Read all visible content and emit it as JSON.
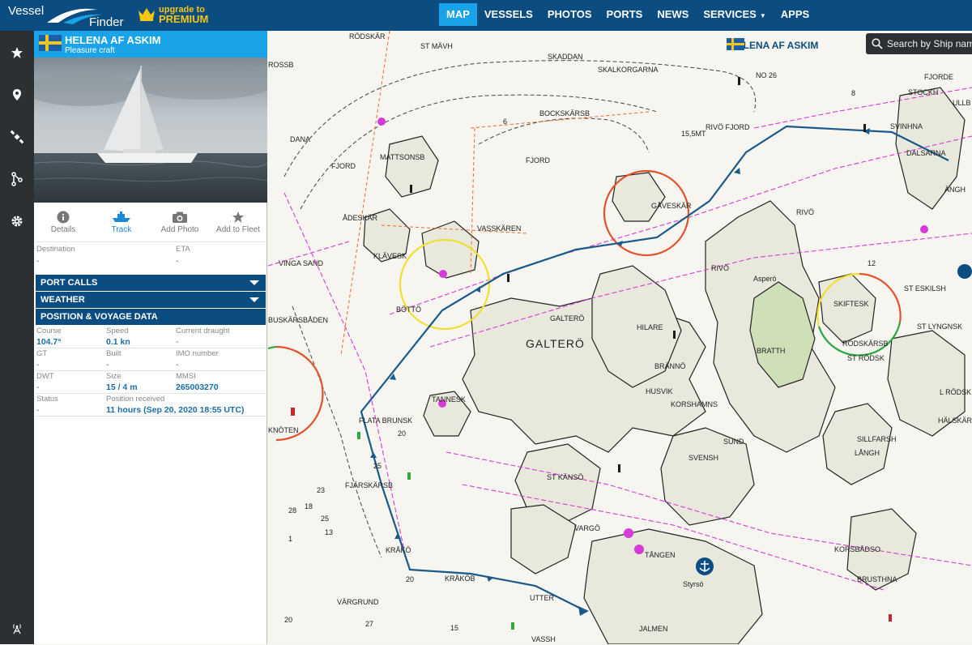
{
  "app": {
    "logo_line1": "Vessel",
    "logo_line2": "Finder"
  },
  "premium": {
    "line1": "upgrade to",
    "line2": "PREMIUM"
  },
  "nav": [
    {
      "label": "MAP",
      "active": true
    },
    {
      "label": "VESSELS"
    },
    {
      "label": "PHOTOS"
    },
    {
      "label": "PORTS"
    },
    {
      "label": "NEWS"
    },
    {
      "label": "SERVICES"
    },
    {
      "label": "APPS"
    }
  ],
  "rail_icons": [
    "star-icon",
    "map-pin-icon",
    "satellite-icon",
    "route-icon",
    "gear-icon",
    "antenna-icon"
  ],
  "vessel": {
    "name": "HELENA AF ASKIM",
    "type": "Pleasure craft",
    "flag_colors": {
      "blue": "#1b5fa8",
      "yellow": "#f5c518"
    }
  },
  "actions": [
    {
      "label": "Details",
      "icon": "info-icon"
    },
    {
      "label": "Track",
      "icon": "ship-track-icon",
      "active": true
    },
    {
      "label": "Add Photo",
      "icon": "camera-icon"
    },
    {
      "label": "Add to Fleet",
      "icon": "star-icon"
    }
  ],
  "destination": {
    "label": "Destination",
    "value": "-"
  },
  "eta": {
    "label": "ETA",
    "value": "-"
  },
  "sections": {
    "port_calls": "PORT CALLS",
    "weather": "WEATHER",
    "position": "POSITION & VOYAGE DATA"
  },
  "voyage": {
    "course": {
      "label": "Course",
      "value": "104.7°"
    },
    "speed": {
      "label": "Speed",
      "value": "0.1 kn"
    },
    "draught": {
      "label": "Current draught",
      "value": "-"
    },
    "gt": {
      "label": "GT",
      "value": "-"
    },
    "built": {
      "label": "Built",
      "value": "-"
    },
    "imo": {
      "label": "IMO number",
      "value": "-"
    },
    "dwt": {
      "label": "DWT",
      "value": "-"
    },
    "size": {
      "label": "Size",
      "value": "15 / 4 m"
    },
    "mmsi": {
      "label": "MMSI",
      "value": "265003270"
    },
    "status": {
      "label": "Status",
      "value": "-"
    },
    "position_received": {
      "label": "Position received",
      "value": "11 hours (Sep 20, 2020 18:55 UTC)"
    }
  },
  "map": {
    "vessel_label": "HELENA AF ASKIM",
    "search_placeholder": "Search by Ship name",
    "labels": {
      "galtero_big": "GALTERÖ",
      "rodskar": "RÖDSKÄR",
      "st_mavh": "ST MÄVH",
      "skaddan": "SKADDAN",
      "skalkorgarna": "SKALKORGARNA",
      "no26": "NO 26",
      "fjorde": "FJORDE",
      "rossb": "ROSSB",
      "stockh": "STOCKH",
      "ullb": "ULLB",
      "bockskarsb": "BOCKSKÄRSB",
      "rivo_fjord": "RIVÖ FJORD",
      "svinhna": "SVINHNA",
      "dana": "DANA",
      "mattsonsb": "MATTSONSB",
      "fjord_left": "FJORD",
      "fjord_mid": "FJORD",
      "mt15": "15,5MT",
      "dalsarna": "DALSARNA",
      "angh": "ÄNGH",
      "gaveskar": "GÅVESKÄR",
      "adeskar": "ÅDESKÄR",
      "vasskaren": "VASSKÄREN",
      "rivo_n": "RIVÖ",
      "rivo": "RIVÖ",
      "aspero": "Asperö",
      "vinga_sand": "VINGA SAND",
      "klavesk": "KLÄVESK",
      "skiftesk": "SKIFTESK",
      "st_eskilsh": "ST ESKILSH",
      "botto": "BÖTTÖ",
      "galtero_small": "GALTERÖ",
      "hilare": "HILARE",
      "st_lyngnsk": "ST LYNGNSK",
      "buskarsbaden": "BUSKÄRSBÅDEN",
      "rodskarsb": "RÖDSKÄRSB",
      "st_rodsk": "ST RÖDSK",
      "brattn": "BRATTH",
      "branno": "BRÄNNÖ",
      "l_rodsk": "L RÖDSK",
      "husvik": "HUSVIK",
      "korshamn": "KORSHAMNS",
      "tannesk": "TANNESK",
      "halskar": "HÄLSKÄR",
      "flata_brunsk": "FLATA BRUNSK",
      "sund": "SUND",
      "sillfarsh": "SILLFARSH",
      "knoten": "KNÖTEN",
      "svensh": "SVENSH",
      "langh": "LÅNGH",
      "st_kanso": "ST KÄNSÖ",
      "fjarskarsb": "FJÄRSKÄRSB",
      "vargo": "VARGÖ",
      "korsbadso": "KORSBÅDSO",
      "krako": "KRÅKÖ",
      "tangen": "TÅNGEN",
      "styrso": "Styrsö",
      "brusthna": "BRUSTHNA",
      "krakob": "KRÅKÖB",
      "utter": "UTTER",
      "vargrund": "VÄRGRUND",
      "jalmen": "JALMEN",
      "vassh": "VASSH"
    }
  }
}
